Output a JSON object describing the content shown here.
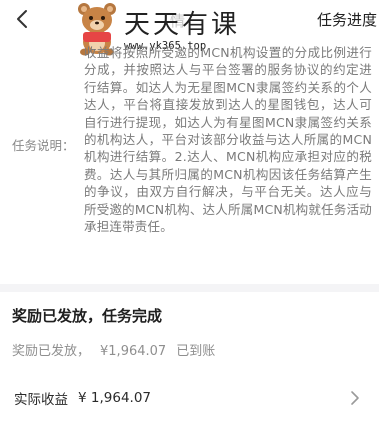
{
  "header": {
    "back_icon": "chevron-left-icon",
    "watermark_title": "天天有课",
    "watermark_url": "www.yk365.top",
    "ghost_title": "情",
    "right_title": "任务进度"
  },
  "description": {
    "label": "任务说明：",
    "text": "收益将按照所受邀的MCN机构设置的分成比例进行分成，并按照达人与平台签署的服务协议的约定进行结算。如达人为无星图MCN隶属签约关系的个人达人，平台将直接发放到达人的星图钱包，达人可自行进行提现，如达人为有星图MCN隶属签约关系的机构达人，平台对该部分收益与达人所属的MCN机构进行结算。2.达人、MCN机构应承担对应的税费。达人与其所归属的MCN机构因该任务结算产生的争议，由双方自行解决，与平台无关。达人应与所受邀的MCN机构、达人所属MCN机构就任务活动承担连带责任。"
  },
  "reward": {
    "title": "奖励已发放，任务完成",
    "status_label": "奖励已发放，",
    "status_amount": "¥1,964.07",
    "status_suffix": "已到账"
  },
  "income": {
    "label": "实际收益",
    "amount": "¥ 1,964.07",
    "chevron_icon": "chevron-right-icon"
  },
  "colors": {
    "primary_text": "#1f1f1f",
    "secondary_text": "#8f8f8f",
    "divider": "#f4f4f6"
  }
}
